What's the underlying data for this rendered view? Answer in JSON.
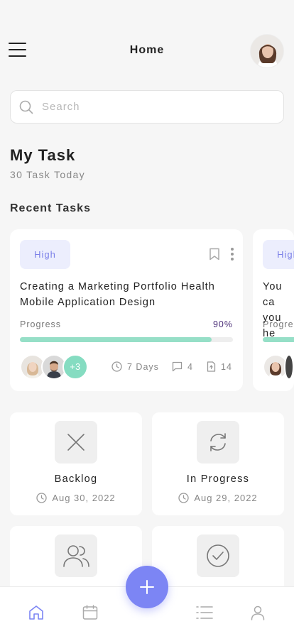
{
  "header": {
    "title": "Home",
    "menu_icon": "hamburger-menu-icon",
    "avatar": "user-avatar"
  },
  "search": {
    "placeholder": "Search",
    "value": ""
  },
  "overview": {
    "title": "My Task",
    "subtitle": "30 Task Today"
  },
  "recent": {
    "heading": "Recent Tasks",
    "tasks": [
      {
        "priority": "High",
        "title": "Creating a Marketing Portfolio Health Mobile Application Design",
        "progress_label": "Progress",
        "progress_value": "90%",
        "progress_fraction": 0.9,
        "extra_members": "+3",
        "days": "7 Days",
        "comments": "4",
        "files": "14"
      },
      {
        "priority": "High",
        "title": "You ca you he",
        "progress_label": "Progre"
      }
    ]
  },
  "categories": [
    {
      "name": "Backlog",
      "date": "Aug 30, 2022",
      "icon": "close-icon"
    },
    {
      "name": "In Progress",
      "date": "Aug 29, 2022",
      "icon": "refresh-icon"
    },
    {
      "name": "",
      "date": "",
      "icon": "users-icon"
    },
    {
      "name": "",
      "date": "",
      "icon": "check-circle-icon"
    }
  ],
  "nav": {
    "items": [
      "home-icon",
      "calendar-icon",
      "list-icon",
      "profile-icon"
    ],
    "fab": "plus-icon"
  },
  "colors": {
    "accent": "#7c85f4",
    "progress": "#96dfc7",
    "badge_bg": "#eceefd",
    "badge_text": "#7b80e8"
  }
}
